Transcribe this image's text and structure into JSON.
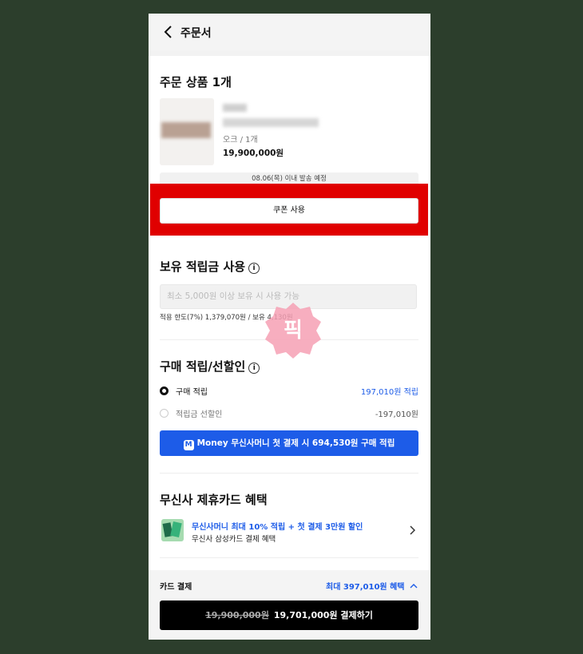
{
  "header": {
    "title": "주문서"
  },
  "product_section": {
    "title": "주문 상품 1개",
    "option": "오크 / 1개",
    "price": "19,900,000원",
    "shipping_note": "08.06(목) 이내 발송 예정",
    "coupon_button": "쿠폰 사용"
  },
  "points_section": {
    "title": "보유 적립금 사용",
    "placeholder": "최소 5,000원 이상 보유 시 사용 가능",
    "limit_text": "적용 한도(7%) 1,379,070원 / 보유 4,130원"
  },
  "purchase_section": {
    "title": "구매 적립/선할인",
    "options": [
      {
        "label": "구매 적립",
        "value": "197,010원 적립",
        "selected": true
      },
      {
        "label": "적립금 선할인",
        "value": "-197,010원",
        "selected": false
      }
    ],
    "money_icon": "M",
    "money_button": "Money 무신사머니 첫 결제 시 694,530원 구매 적립"
  },
  "card_section": {
    "title": "무신사 제휴카드 혜택",
    "link_text": "무신사머니 최대 10% 적립 + 첫 결제 3만원 할인",
    "sub_text": "무신사 삼성카드 결제 혜택"
  },
  "footer": {
    "payment_label": "카드 결제",
    "benefit": "최대 397,010원 혜택",
    "original_price": "19,900,000원",
    "pay_button": "19,701,000원 결제하기"
  },
  "watermark": {
    "text": "픽"
  },
  "colors": {
    "accent": "#1d5ce8",
    "highlight": "#e00000",
    "background": "#2c3e2c"
  },
  "icons": [
    "back-arrow-icon",
    "info-icon",
    "money-icon",
    "chevron-right-icon",
    "chevron-up-icon",
    "card-image"
  ]
}
